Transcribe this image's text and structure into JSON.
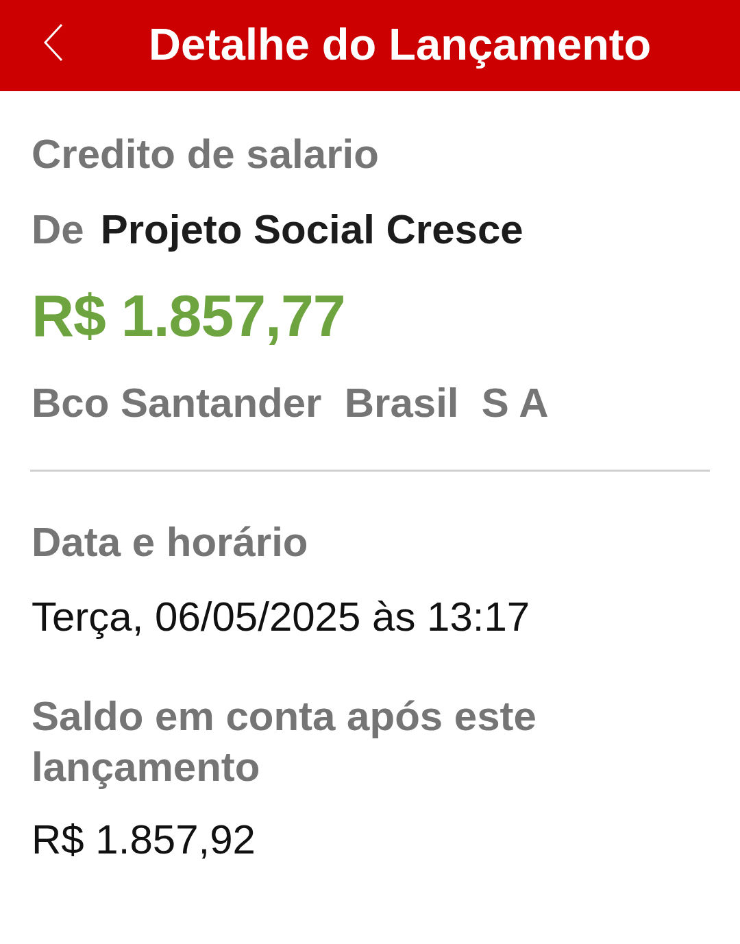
{
  "header": {
    "title": "Detalhe do Lançamento"
  },
  "transaction": {
    "description": "Credito de salario",
    "from_label": "De",
    "from_name": "Projeto Social Cresce",
    "amount": "R$ 1.857,77",
    "bank": "Bco Santander  Brasil  S A"
  },
  "details": [
    {
      "label": "Data e horário",
      "value": "Terça, 06/05/2025 às 13:17"
    },
    {
      "label": "Saldo em conta após este lançamento",
      "value": "R$ 1.857,92"
    }
  ]
}
